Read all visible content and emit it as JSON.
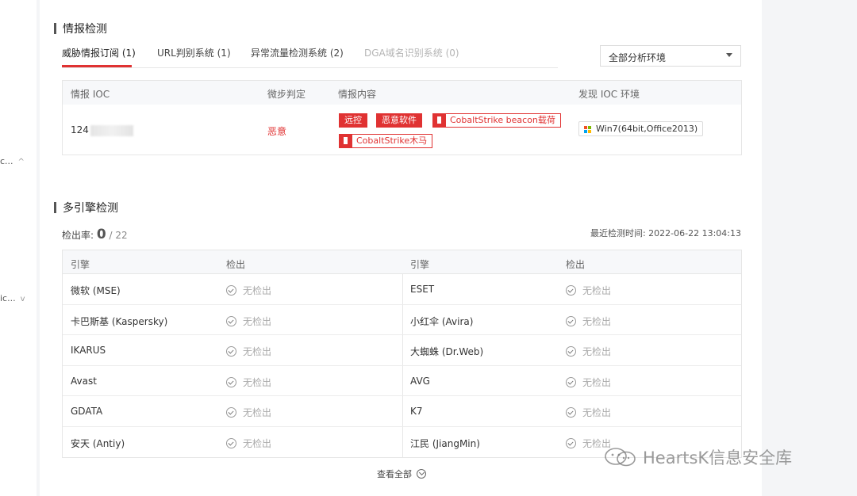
{
  "sidebar": {
    "item1": {
      "label": "c...",
      "chevron": "^"
    },
    "item2": {
      "label": "ic...",
      "chevron": "v"
    }
  },
  "intel": {
    "title": "情报检测",
    "tabs": [
      {
        "label": "威胁情报订阅 (1)"
      },
      {
        "label": "URL判别系统 (1)"
      },
      {
        "label": "异常流量检测系统 (2)"
      },
      {
        "label": "DGA域名识别系统 (0)"
      }
    ],
    "env_select": "全部分析环境",
    "table": {
      "headers": [
        "情报 IOC",
        "微步判定",
        "情报内容",
        "发现 IOC 环境"
      ],
      "row": {
        "ioc": "124",
        "verdict": "恶意",
        "tags": [
          "远控",
          "恶意软件",
          "CobaltStrike beacon载荷",
          "CobaltStrike木马"
        ],
        "env": "Win7(64bit,Office2013)"
      }
    }
  },
  "engines": {
    "title": "多引擎检测",
    "rate_label": "检出率:",
    "rate_num": "0",
    "rate_den": "/ 22",
    "last_time": "最近检测时间: 2022-06-22 13:04:13",
    "headers": [
      "引擎",
      "检出",
      "引擎",
      "检出"
    ],
    "rows": [
      {
        "left": "微软 (MSE)",
        "left_result": "无检出",
        "right": "ESET",
        "right_result": "无检出"
      },
      {
        "left": "卡巴斯基 (Kaspersky)",
        "left_result": "无检出",
        "right": "小红伞 (Avira)",
        "right_result": "无检出"
      },
      {
        "left": "IKARUS",
        "left_result": "无检出",
        "right": "大蜘蛛 (Dr.Web)",
        "right_result": "无检出"
      },
      {
        "left": "Avast",
        "left_result": "无检出",
        "right": "AVG",
        "right_result": "无检出"
      },
      {
        "left": "GDATA",
        "left_result": "无检出",
        "right": "K7",
        "right_result": "无检出"
      },
      {
        "left": "安天 (Antiy)",
        "left_result": "无检出",
        "right": "江民 (JiangMin)",
        "right_result": "无检出"
      }
    ],
    "view_all": "查看全部"
  },
  "watermark": "HeartsK信息安全库",
  "colors": {
    "accent": "#e03232"
  }
}
